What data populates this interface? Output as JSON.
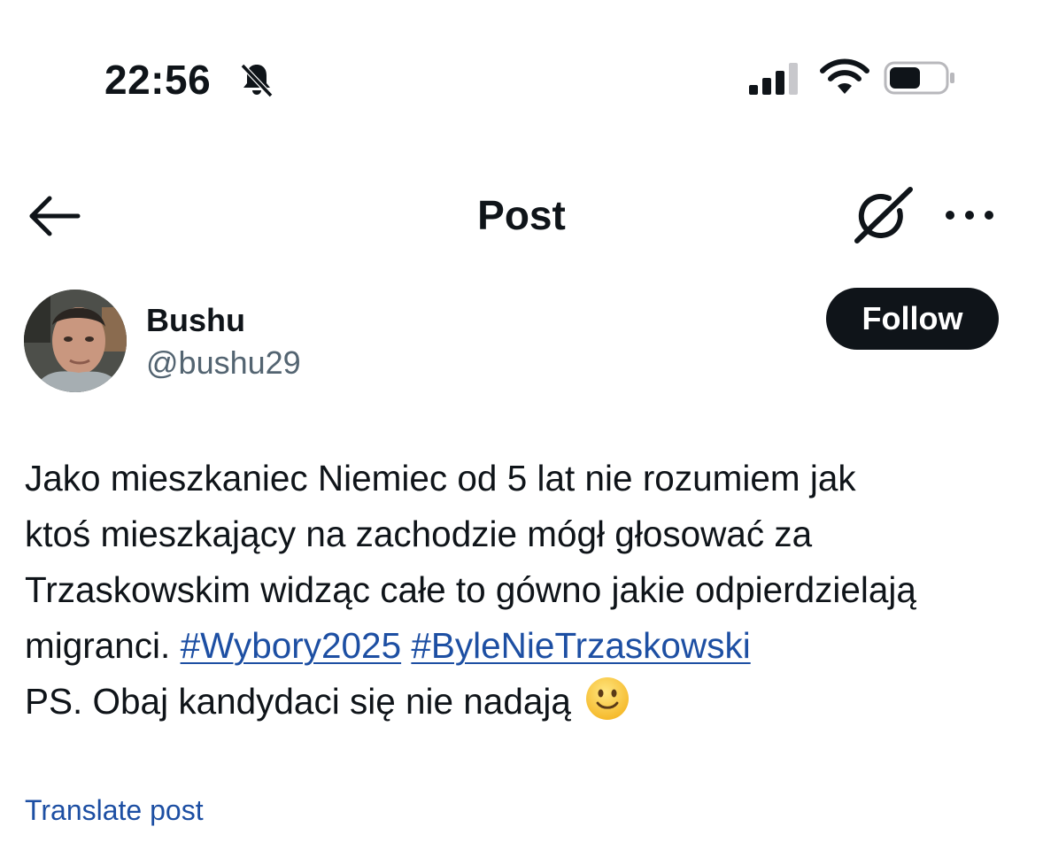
{
  "status_bar": {
    "time": "22:56",
    "silent_icon": "bell-slash-icon",
    "signal_icon": "cellular-signal-icon",
    "wifi_icon": "wifi-icon",
    "battery_icon": "battery-icon"
  },
  "header": {
    "back_icon": "arrow-left-icon",
    "title": "Post",
    "grok_icon": "grok-icon",
    "more_icon": "more-dots-icon"
  },
  "author": {
    "display_name": "Bushu",
    "handle": "@bushu29",
    "follow_label": "Follow"
  },
  "post": {
    "line_1": "Jako mieszkaniec Niemiec od 5 lat nie rozumiem jak",
    "line_2": "ktoś mieszkający na zachodzie mógł głosować za",
    "line_3": "Trzaskowskim widząc całe to gówno jakie odpierdzielają",
    "line_4_text": "migranci.",
    "hashtags": [
      "#Wybory2025",
      "#ByleNieTrzaskowski"
    ],
    "line_5": "PS. Obaj kandydaci się nie nadają",
    "emoji": "slightly-smiling-face-emoji"
  },
  "translate_label": "Translate post",
  "colors": {
    "text": "#0f1419",
    "secondary_text": "#536471",
    "link": "#1d4fa3",
    "follow_bg": "#0f1419",
    "follow_text": "#ffffff"
  }
}
